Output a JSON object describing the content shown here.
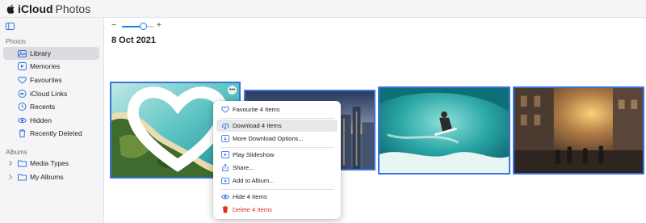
{
  "app": {
    "brand": "iCloud",
    "product": "Photos"
  },
  "sidebar": {
    "photos_heading": "Photos",
    "items": [
      {
        "label": "Library",
        "icon": "library-icon",
        "selected": true
      },
      {
        "label": "Memories",
        "icon": "memories-icon"
      },
      {
        "label": "Favourites",
        "icon": "heart-icon"
      },
      {
        "label": "iCloud Links",
        "icon": "cloud-link-icon"
      },
      {
        "label": "Recents",
        "icon": "clock-icon"
      },
      {
        "label": "Hidden",
        "icon": "eye-icon"
      },
      {
        "label": "Recently Deleted",
        "icon": "trash-icon"
      }
    ],
    "albums_heading": "Albums",
    "album_items": [
      {
        "label": "Media Types",
        "icon": "folder-icon"
      },
      {
        "label": "My Albums",
        "icon": "folder-icon"
      }
    ]
  },
  "toolbar": {
    "zoom_minus": "−",
    "zoom_plus": "+",
    "zoom_level": 0.65
  },
  "main": {
    "date_title": "8 Oct 2021"
  },
  "photos": [
    {
      "name": "aerial-island",
      "selected": true,
      "favourite": true
    },
    {
      "name": "city-skyline",
      "selected": true
    },
    {
      "name": "surfer-wave",
      "selected": true
    },
    {
      "name": "city-street",
      "selected": true
    }
  ],
  "context_menu": {
    "items": [
      {
        "label": "Favourite 4 Items",
        "icon": "heart-icon"
      },
      {
        "label": "Download 4 Items",
        "icon": "download-icon",
        "highlighted": true
      },
      {
        "label": "More Download Options...",
        "icon": "download-options-icon"
      },
      {
        "label": "Play Slideshow",
        "icon": "play-icon"
      },
      {
        "label": "Share...",
        "icon": "share-icon"
      },
      {
        "label": "Add to Album...",
        "icon": "add-album-icon"
      },
      {
        "label": "Hide 4 Items",
        "icon": "eye-icon"
      },
      {
        "label": "Delete 4 Items",
        "icon": "trash-icon",
        "danger": true
      }
    ]
  },
  "colors": {
    "accent": "#3a73e0",
    "danger": "#d93025",
    "sidebar_bg": "#f5f5f7"
  }
}
